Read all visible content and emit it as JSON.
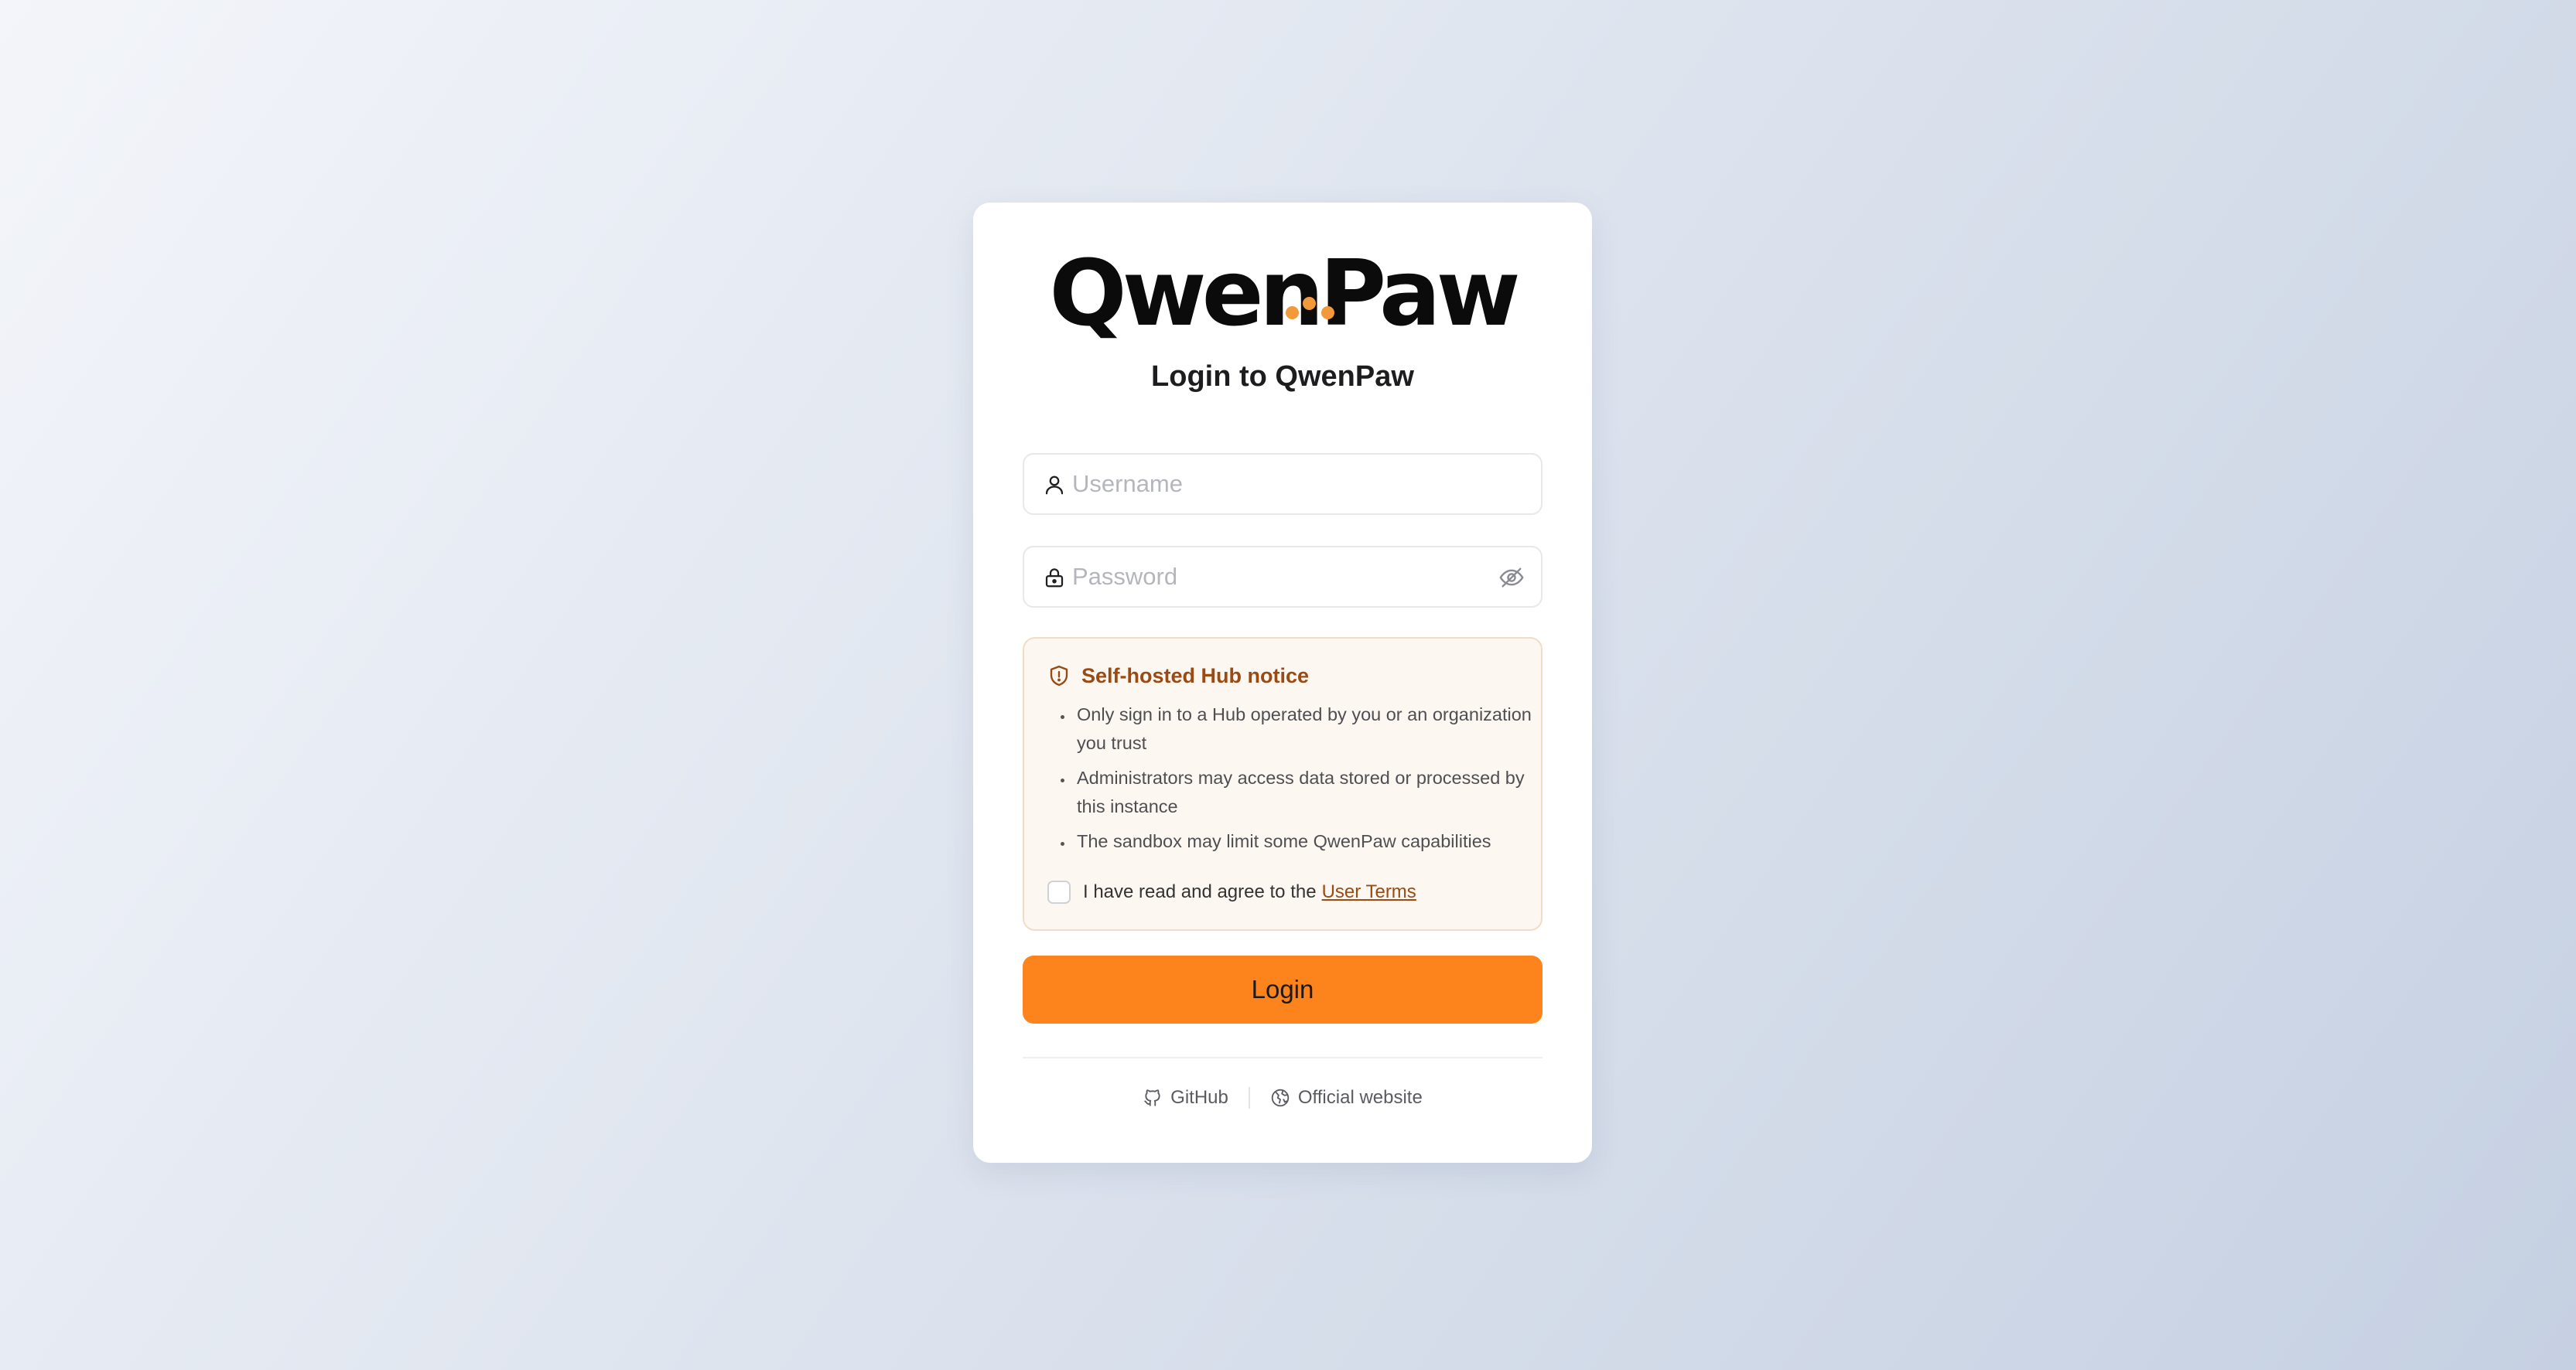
{
  "logo": {
    "text": "QwenPaw",
    "accent_color": "#f29a3a"
  },
  "title": "Login to QwenPaw",
  "username": {
    "placeholder": "Username",
    "value": "",
    "icon": "user-icon"
  },
  "password": {
    "placeholder": "Password",
    "value": "",
    "icon": "lock-icon",
    "toggle_icon": "eye-off-icon"
  },
  "notice": {
    "title": "Self-hosted Hub notice",
    "icon": "shield-alert-icon",
    "items": [
      "Only sign in to a Hub operated by you or an organization you trust",
      "Administrators may access data stored or processed by this instance",
      "The sandbox may limit some QwenPaw capabilities"
    ],
    "agree_text": "I have read and agree to the",
    "agree_link": "User Terms",
    "agree_checked": false
  },
  "login_button": {
    "label": "Login",
    "color": "#fd831d"
  },
  "footer": {
    "github_label": "GitHub",
    "github_icon": "github-icon",
    "website_label": "Official website",
    "website_icon": "globe-icon"
  }
}
